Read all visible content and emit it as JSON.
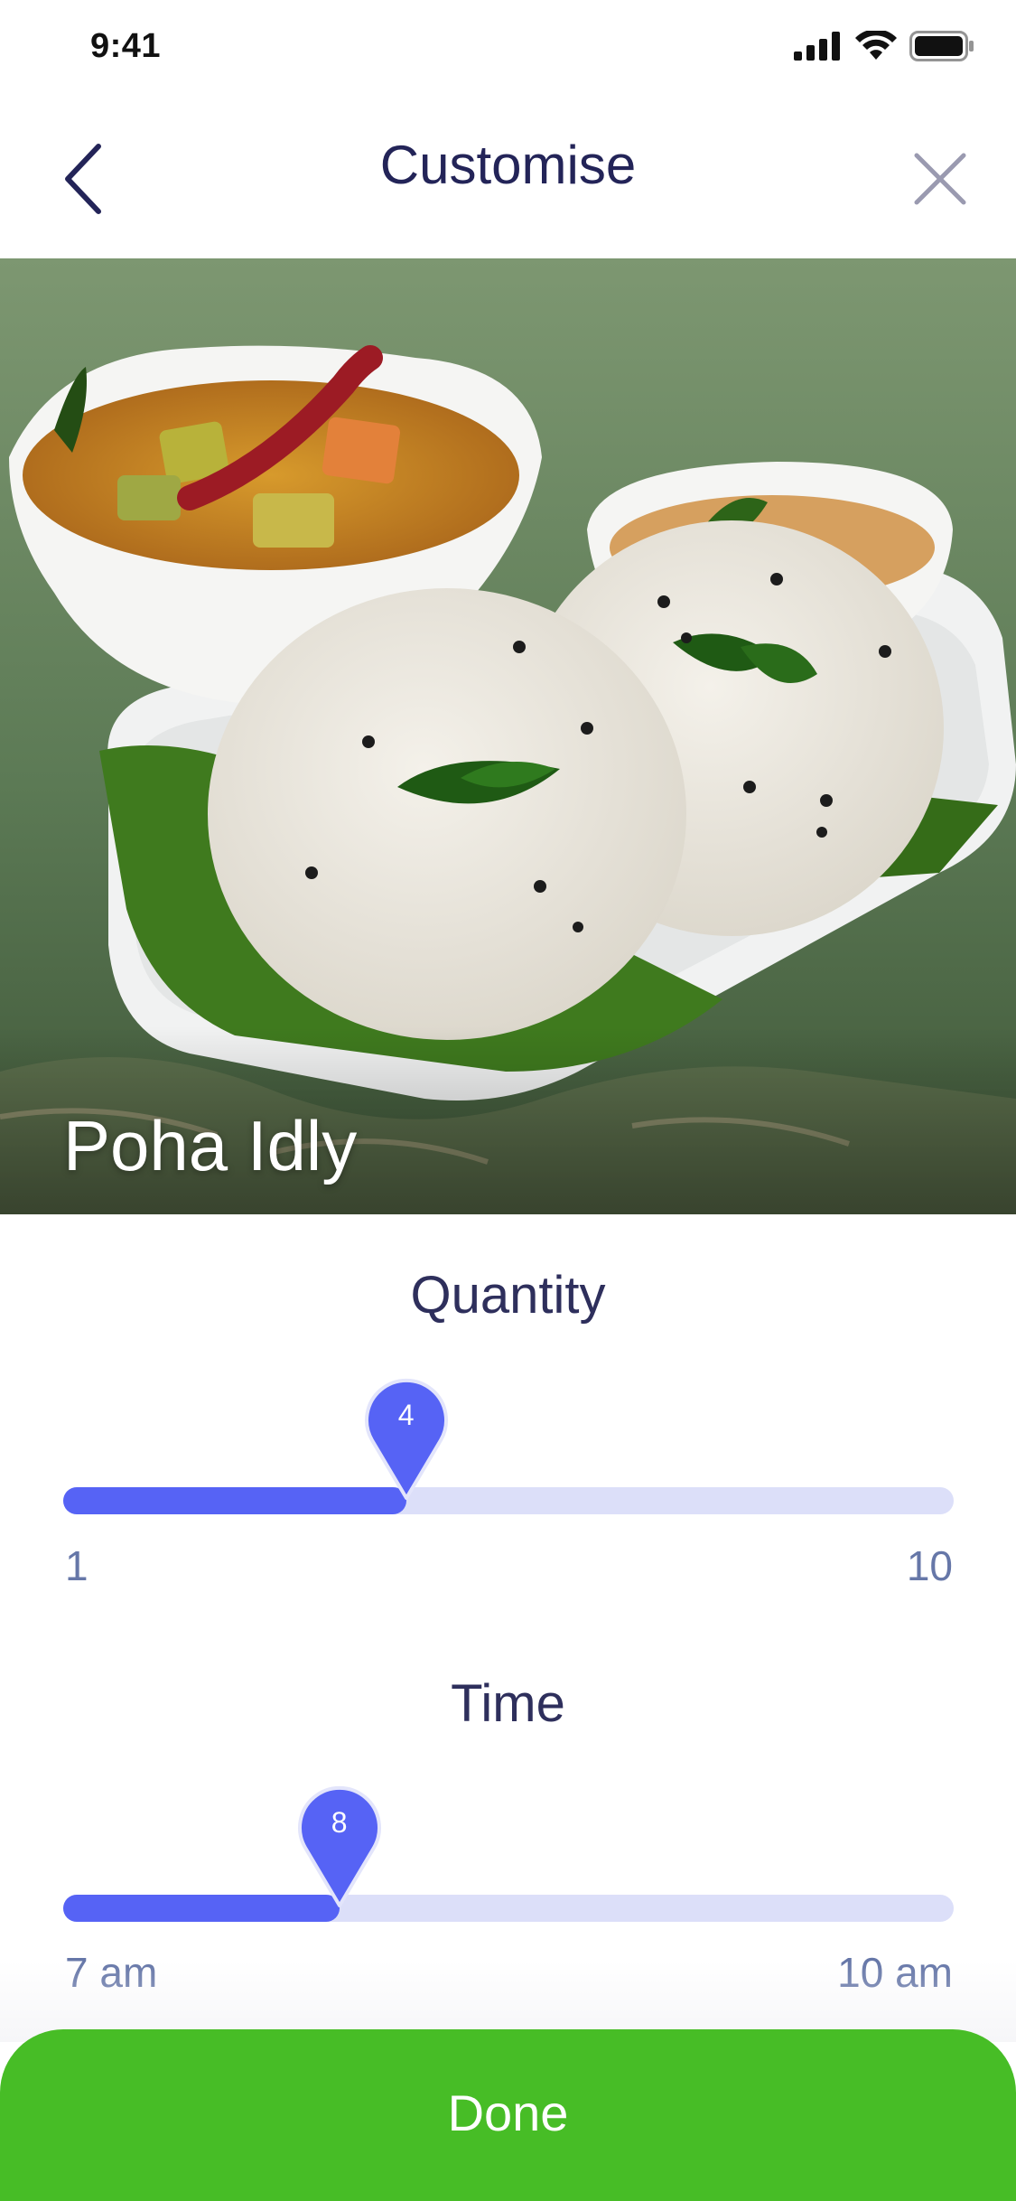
{
  "status": {
    "time": "9:41"
  },
  "header": {
    "title": "Customise"
  },
  "hero": {
    "title": "Poha Idly"
  },
  "quantity": {
    "label": "Quantity",
    "min_label": "1",
    "max_label": "10",
    "value": "4",
    "fraction": 0.385
  },
  "time": {
    "label": "Time",
    "min_label": "7 am",
    "max_label": "10 am",
    "value": "8",
    "fraction": 0.31
  },
  "actions": {
    "done_label": "Done"
  },
  "colors": {
    "accent": "#5663f5",
    "track": "#dcdff9",
    "done": "#47bd26",
    "title": "#232458"
  }
}
